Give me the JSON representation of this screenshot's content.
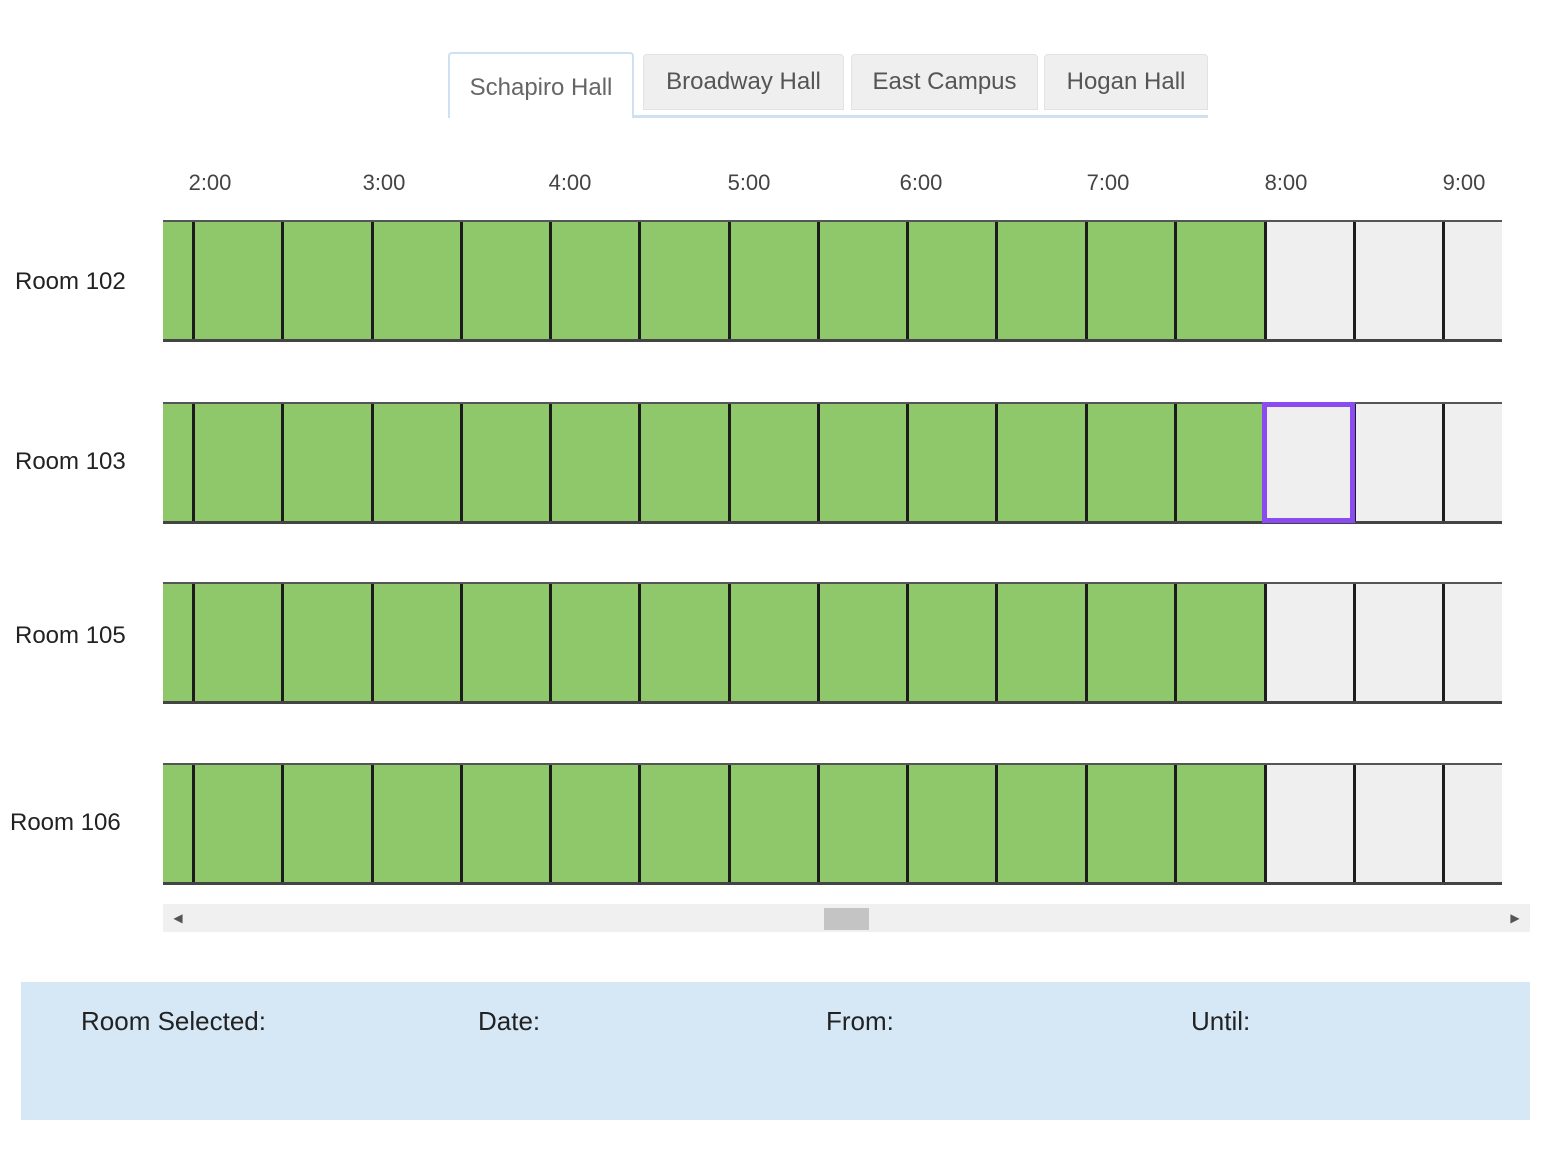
{
  "tabs": [
    {
      "label": "Schapiro Hall",
      "active": true
    },
    {
      "label": "Broadway Hall",
      "active": false
    },
    {
      "label": "East Campus",
      "active": false
    },
    {
      "label": "Hogan Hall",
      "active": false
    }
  ],
  "hours": [
    "2:00",
    "3:00",
    "4:00",
    "5:00",
    "6:00",
    "7:00",
    "8:00",
    "9:00"
  ],
  "rooms": [
    {
      "name": "Room 102"
    },
    {
      "name": "Room 103"
    },
    {
      "name": "Room 105"
    },
    {
      "name": "Room 106"
    }
  ],
  "slot_status": {
    "pattern": [
      "available",
      "available",
      "available",
      "available",
      "available",
      "available",
      "available",
      "available",
      "available",
      "available",
      "available",
      "available",
      "unavailable",
      "unavailable",
      "unavailable",
      "available"
    ],
    "selected": {
      "room_index": 1,
      "slot_index": 12
    }
  },
  "info_panel": {
    "room_label": "Room Selected:",
    "date_label": "Date:",
    "from_label": "From:",
    "until_label": "Until:"
  },
  "colors": {
    "available": "#8ec86a",
    "unavailable": "#efefef",
    "selection_outline": "#8a4cf0",
    "info_panel_bg": "#d6e8f6"
  },
  "icons": {
    "scroll_left": "triangle-left-icon",
    "scroll_right": "triangle-right-icon"
  }
}
